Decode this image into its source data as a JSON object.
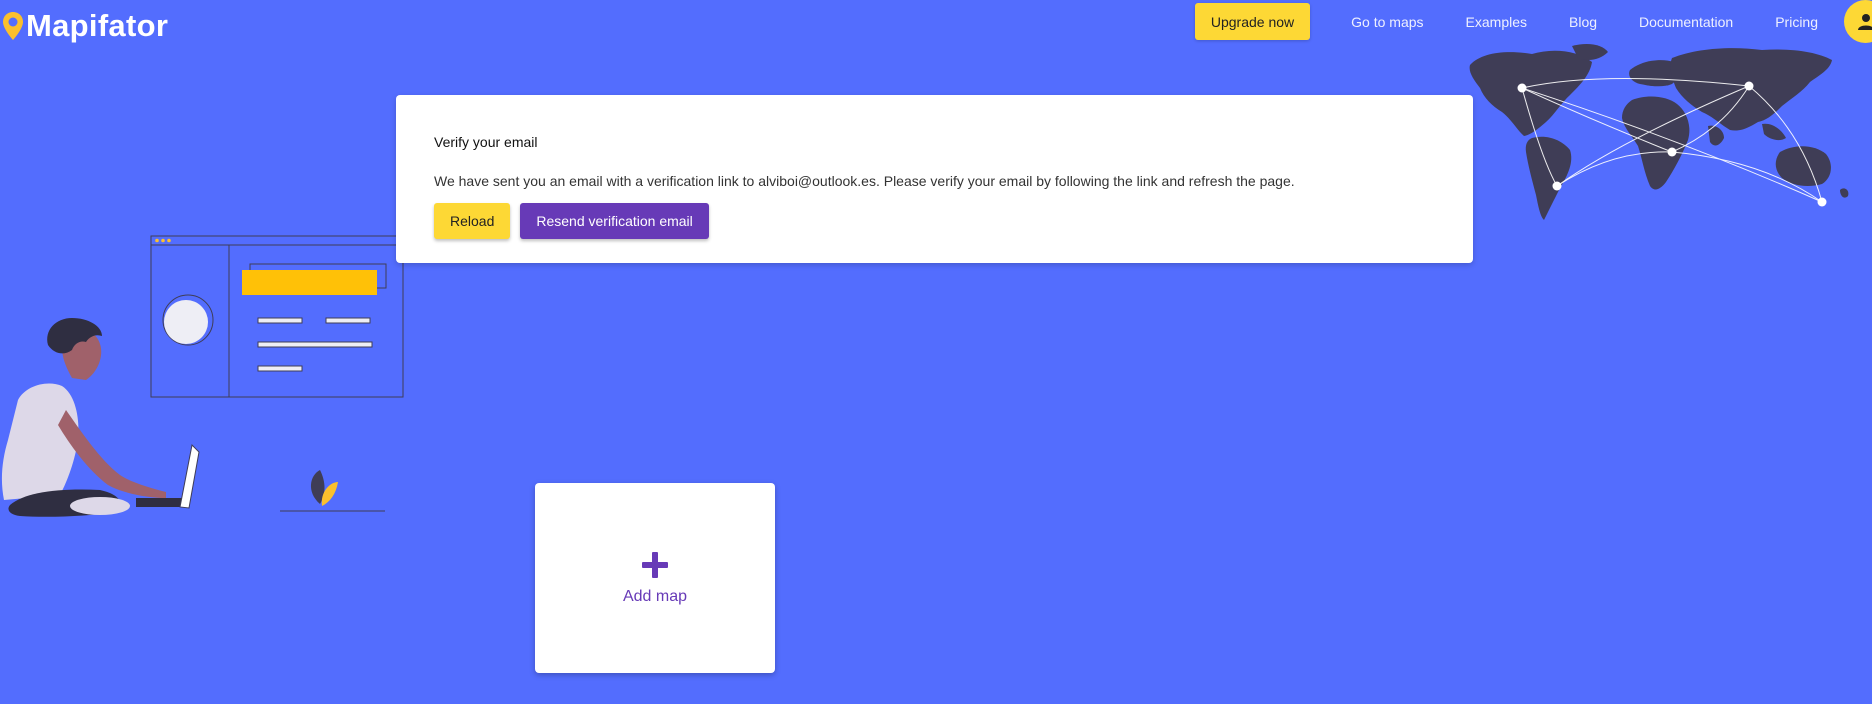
{
  "app": {
    "name": "Mapifator"
  },
  "nav": {
    "upgrade_label": "Upgrade now",
    "links": [
      "Go to maps",
      "Examples",
      "Blog",
      "Documentation",
      "Pricing"
    ]
  },
  "verify": {
    "title": "Verify your email",
    "message": "We have sent you an email with a verification link to alviboi@outlook.es. Please verify your email by following the link and refresh the page.",
    "reload_label": "Reload",
    "resend_label": "Resend verification email"
  },
  "add_map": {
    "label": "Add map",
    "icon": "plus-icon"
  },
  "colors": {
    "background": "#536dfe",
    "accent_yellow": "#fdd835",
    "primary_purple": "#673ab7",
    "map_dark": "#3f3d56"
  }
}
